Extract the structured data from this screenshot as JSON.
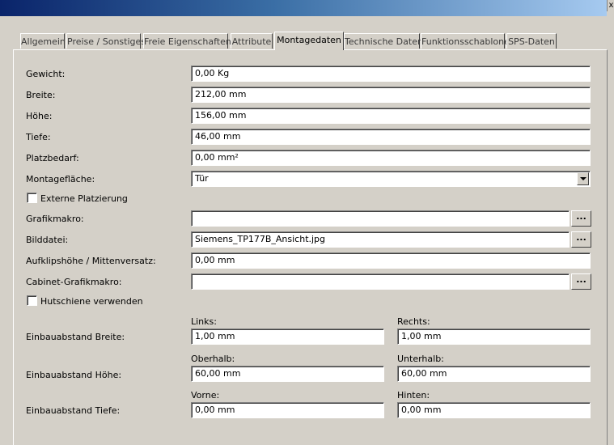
{
  "window": {
    "close_glyph": "x"
  },
  "tabs": [
    {
      "label": "Allgemein",
      "active": false
    },
    {
      "label": "Preise / Sonstiges",
      "active": false
    },
    {
      "label": "Freie Eigenschaften",
      "active": false
    },
    {
      "label": "Attribute",
      "active": false
    },
    {
      "label": "Montagedaten",
      "active": true
    },
    {
      "label": "Technische Daten",
      "active": false
    },
    {
      "label": "Funktionsschablone",
      "active": false
    },
    {
      "label": "SPS-Daten",
      "active": false
    }
  ],
  "form": {
    "gewicht": {
      "label": "Gewicht:",
      "value": "0,00 Kg"
    },
    "breite": {
      "label": "Breite:",
      "value": "212,00 mm"
    },
    "hoehe": {
      "label": "Höhe:",
      "value": "156,00 mm"
    },
    "tiefe": {
      "label": "Tiefe:",
      "value": "46,00 mm"
    },
    "platzbedarf": {
      "label": "Platzbedarf:",
      "value": "0,00 mm²"
    },
    "montageflaeche": {
      "label": "Montagefläche:",
      "value": "Tür"
    },
    "externe_platzierung": {
      "label": "Externe Platzierung",
      "checked": false
    },
    "grafikmakro": {
      "label": "Grafikmakro:",
      "value": "",
      "browse": "..."
    },
    "bilddatei": {
      "label": "Bilddatei:",
      "value": "Siemens_TP177B_Ansicht.jpg",
      "browse": "..."
    },
    "aufklipshoehe": {
      "label": "Aufklipshöhe / Mittenversatz:",
      "value": "0,00 mm"
    },
    "cabinet_grafikmakro": {
      "label": "Cabinet-Grafikmakro:",
      "value": "",
      "browse": "..."
    },
    "hutschiene": {
      "label": "Hutschiene verwenden",
      "checked": false
    },
    "einbau_breite": {
      "label": "Einbauabstand Breite:",
      "left_label": "Links:",
      "left_value": "1,00 mm",
      "right_label": "Rechts:",
      "right_value": "1,00 mm"
    },
    "einbau_hoehe": {
      "label": "Einbauabstand Höhe:",
      "left_label": "Oberhalb:",
      "left_value": "60,00 mm",
      "right_label": "Unterhalb:",
      "right_value": "60,00 mm"
    },
    "einbau_tiefe": {
      "label": "Einbauabstand Tiefe:",
      "left_label": "Vorne:",
      "left_value": "0,00 mm",
      "right_label": "Hinten:",
      "right_value": "0,00 mm"
    }
  }
}
